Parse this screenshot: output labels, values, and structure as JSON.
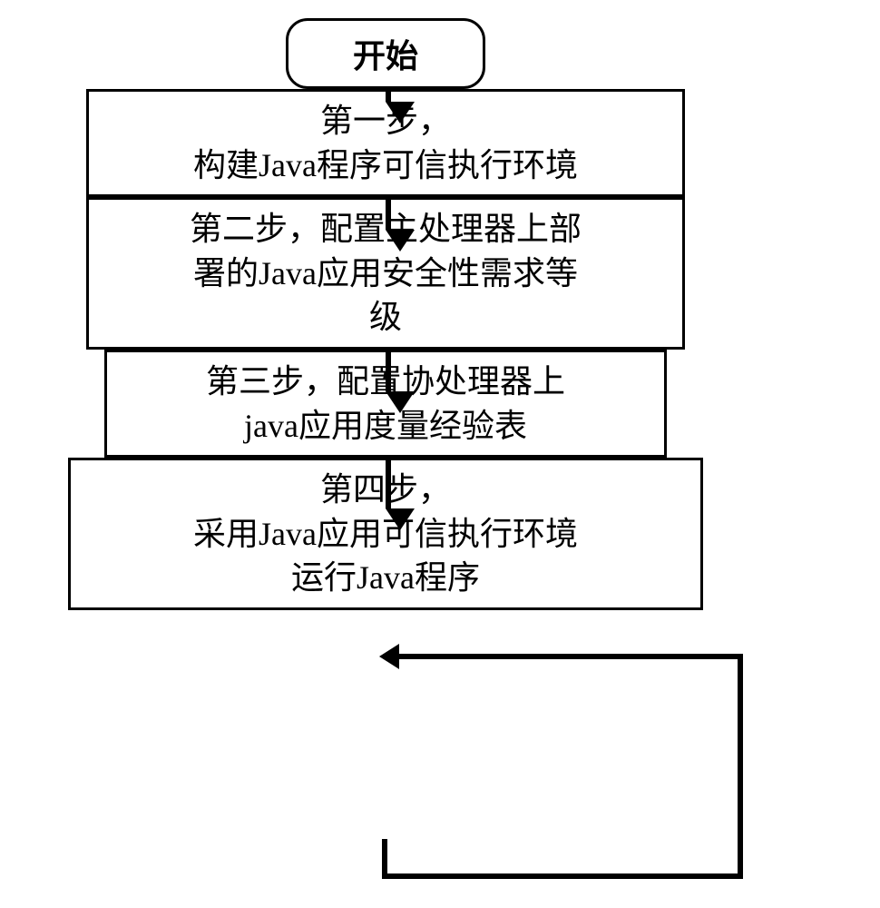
{
  "chart_data": {
    "type": "diagram",
    "title": "",
    "nodes": [
      {
        "id": "start",
        "type": "terminator",
        "label": "开始"
      },
      {
        "id": "step1",
        "type": "process",
        "line1": "第一步，",
        "line2": "构建Java程序可信执行环境"
      },
      {
        "id": "step2",
        "type": "process",
        "line1": "第二步，配置主处理器上部",
        "line2": "署的Java应用安全性需求等",
        "line3": "级"
      },
      {
        "id": "step3",
        "type": "process",
        "line1": "第三步，配置协处理器上",
        "line2": "java应用度量经验表"
      },
      {
        "id": "step4",
        "type": "process",
        "line1": "第四步，",
        "line2": "采用Java应用可信执行环境",
        "line3": "运行Java程序"
      }
    ],
    "edges": [
      {
        "from": "start",
        "to": "step1"
      },
      {
        "from": "step1",
        "to": "step2"
      },
      {
        "from": "step2",
        "to": "step3"
      },
      {
        "from": "step3",
        "to": "step4"
      },
      {
        "from": "step4",
        "to": "step4",
        "loop": true
      }
    ]
  }
}
